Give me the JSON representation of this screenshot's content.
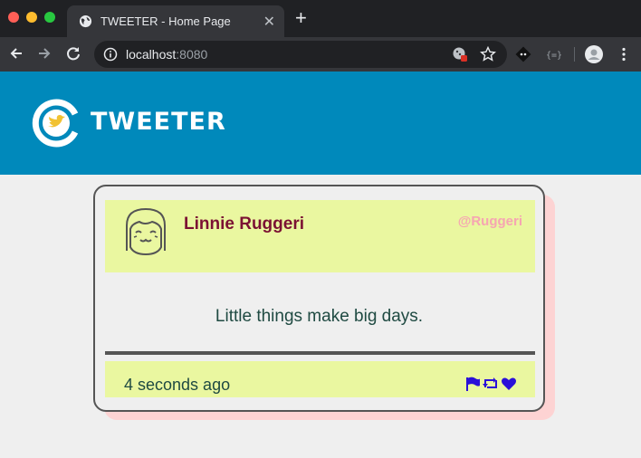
{
  "browser": {
    "tab_title": "TWEETER - Home Page",
    "url_host": "localhost",
    "url_port": ":8080",
    "icons": [
      "globe-icon",
      "close-icon",
      "plus-icon",
      "back-icon",
      "forward-icon",
      "reload-icon",
      "info-icon",
      "blocked-cookies-icon",
      "star-icon",
      "git-extension-icon",
      "json-extension-icon",
      "profile-icon",
      "menu-icon"
    ]
  },
  "header": {
    "brand": "TWEETER",
    "logo_icon": "bird-logo-icon",
    "color": "#0089bb"
  },
  "tweet": {
    "user_name": "Linnie Ruggeri",
    "handle": "@Ruggeri",
    "text": "Little things make big days.",
    "time": "4 seconds ago",
    "actions": [
      "flag-icon",
      "retweet-icon",
      "heart-icon"
    ],
    "accent": "#eaf7a0"
  }
}
